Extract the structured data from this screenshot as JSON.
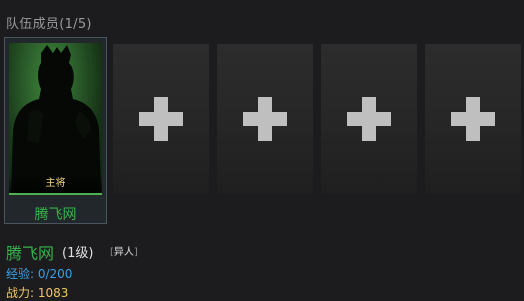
{
  "team": {
    "title": "队伍成员(1/5)",
    "leader": {
      "role_label": "主将",
      "name": "腾飞网",
      "portrait_icon": "general-silhouette-icon"
    },
    "empty_slot_icon": "plus-icon"
  },
  "member_info": {
    "name": "腾飞网",
    "level_text": "(1级)",
    "type_tag": "异人",
    "exp_text": "经验: 0/200",
    "power_text": "战力: 1083"
  },
  "colors": {
    "name_green": "#37b34a",
    "exp_blue": "#3aa0e8",
    "power_gold": "#f0c766",
    "leader_tag_gold": "#f4d57a"
  }
}
